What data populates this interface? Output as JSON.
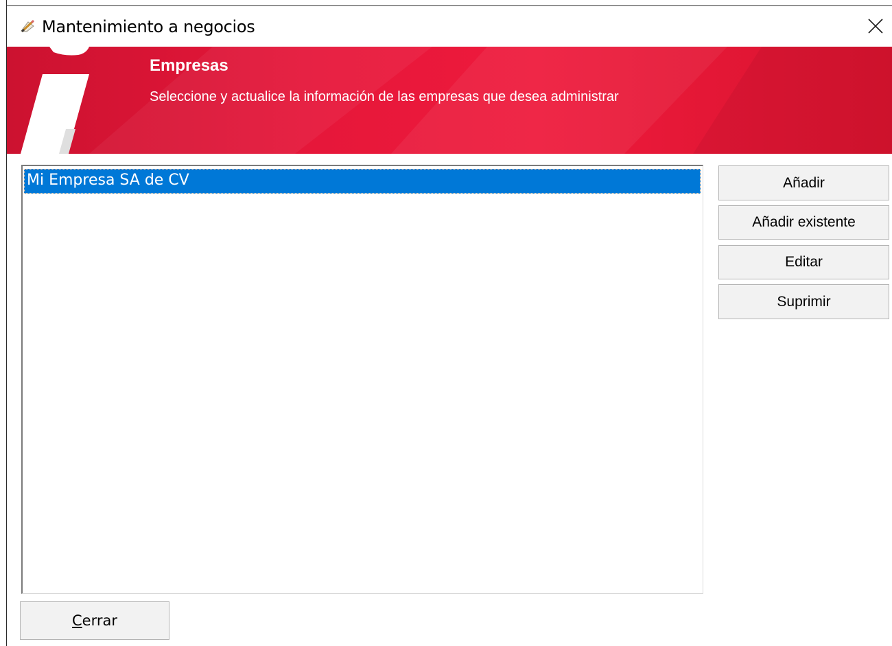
{
  "window": {
    "title": "Mantenimiento a negocios",
    "icon": "pencil-paper-icon"
  },
  "banner": {
    "title": "Empresas",
    "subtitle": "Seleccione y actualice la información de las empresas que desea administrar",
    "accent_color": "#e6173a"
  },
  "list": {
    "items": [
      {
        "label": "Mi Empresa SA de CV",
        "selected": true
      }
    ],
    "selection_color": "#0078d7"
  },
  "actions": {
    "add_label": "Añadir",
    "add_existing_label": "Añadir existente",
    "edit_label": "Editar",
    "delete_label": "Suprimir"
  },
  "footer": {
    "close_accel": "C",
    "close_rest": "errar"
  }
}
